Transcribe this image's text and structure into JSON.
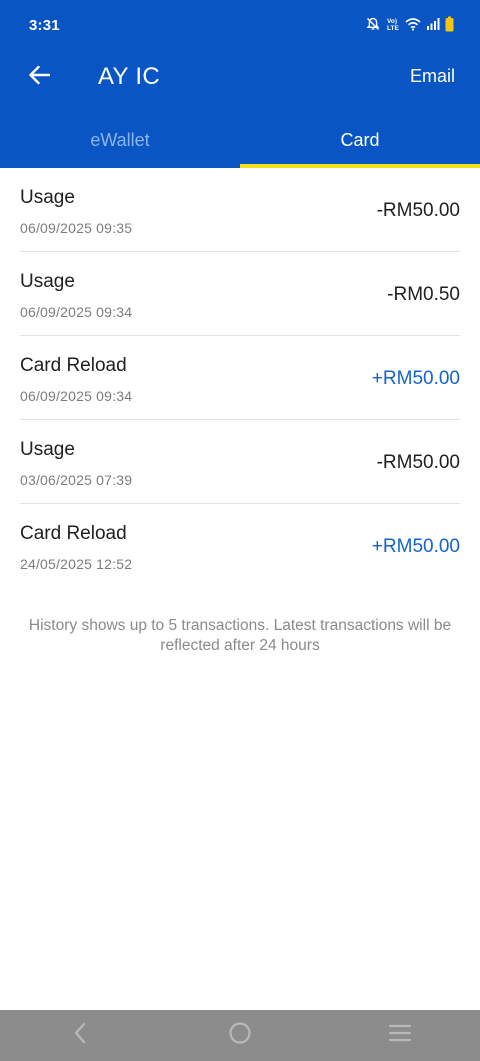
{
  "status_bar": {
    "time": "3:31",
    "icons": [
      "mute-bell-icon",
      "volte-icon",
      "wifi-icon",
      "signal-icon",
      "battery-icon"
    ]
  },
  "header": {
    "title": "AY IC",
    "action_label": "Email",
    "back_icon": "arrow-left-icon"
  },
  "tabs": [
    {
      "label": "eWallet",
      "active": false
    },
    {
      "label": "Card",
      "active": true
    }
  ],
  "transactions": [
    {
      "type": "Usage",
      "date": "06/09/2025 09:35",
      "amount": "-RM50.00",
      "direction": "debit"
    },
    {
      "type": "Usage",
      "date": "06/09/2025 09:34",
      "amount": "-RM0.50",
      "direction": "debit"
    },
    {
      "type": "Card Reload",
      "date": "06/09/2025 09:34",
      "amount": "+RM50.00",
      "direction": "credit"
    },
    {
      "type": "Usage",
      "date": "03/06/2025 07:39",
      "amount": "-RM50.00",
      "direction": "debit"
    },
    {
      "type": "Card Reload",
      "date": "24/05/2025 12:52",
      "amount": "+RM50.00",
      "direction": "credit"
    }
  ],
  "footnote": "History shows up to 5 transactions. Latest transactions will be reflected after 24 hours",
  "nav_bar": {
    "buttons": [
      "back-nav-icon",
      "home-nav-icon",
      "recents-nav-icon"
    ]
  },
  "colors": {
    "brand_blue": "#0a55c4",
    "tab_indicator": "#f2df1e",
    "credit_text": "#1264cf",
    "debit_text": "#1f1f1f",
    "nav_bar": "#8c8c8c"
  }
}
